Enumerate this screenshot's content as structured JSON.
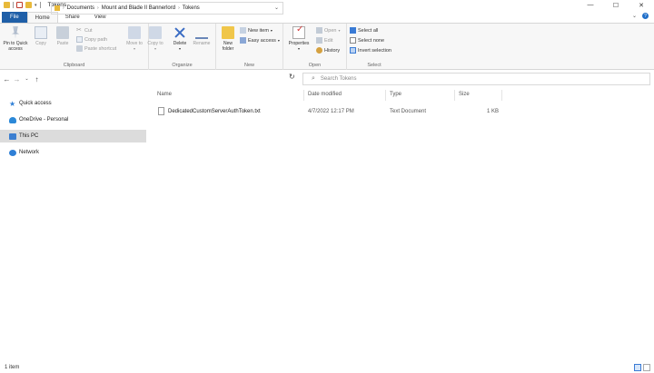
{
  "window": {
    "title": "Tokens",
    "controls": [
      "—",
      "☐",
      "✕"
    ]
  },
  "ribbon_tabs": [
    {
      "label": "File"
    },
    {
      "label": "Home"
    },
    {
      "label": "Share"
    },
    {
      "label": "View"
    }
  ],
  "ribbon": {
    "clipboard": {
      "label": "Clipboard",
      "pin_quick_access": "Pin to Quick access",
      "copy": "Copy",
      "paste": "Paste",
      "cut": "Cut",
      "copy_path": "Copy path",
      "paste_shortcut": "Paste shortcut"
    },
    "organize": {
      "label": "Organize",
      "move_to": "Move to",
      "copy_to": "Copy to",
      "delete": "Delete",
      "rename": "Rename"
    },
    "new": {
      "label": "New",
      "new_folder": "New folder",
      "new_item": "New item",
      "easy_access": "Easy access"
    },
    "open": {
      "label": "Open",
      "properties": "Properties",
      "open": "Open",
      "edit": "Edit",
      "history": "History"
    },
    "select": {
      "label": "Select",
      "select_all": "Select all",
      "select_none": "Select none",
      "invert_selection": "Invert selection"
    }
  },
  "address_bar": {
    "crumbs": [
      "Documents",
      "Mount and Blade II Bannerlord",
      "Tokens"
    ],
    "search_placeholder": "Search Tokens"
  },
  "nav_pane": {
    "items": [
      {
        "label": "Quick access",
        "icon": "star-icon"
      },
      {
        "label": "OneDrive - Personal",
        "icon": "cloud-icon"
      },
      {
        "label": "This PC",
        "icon": "computer-icon",
        "selected": true
      },
      {
        "label": "Network",
        "icon": "network-icon"
      }
    ]
  },
  "file_list": {
    "columns": [
      "Name",
      "Date modified",
      "Type",
      "Size"
    ],
    "rows": [
      {
        "name": "DedicatedCustomServerAuthToken.txt",
        "date_modified": "4/7/2022 12:17 PM",
        "type": "Text Document",
        "size": "1 KB"
      }
    ]
  },
  "status_bar": {
    "item_count": "1 item"
  },
  "colors": {
    "file_tab": "#1f5fa8",
    "selected_nav": "#dcdcdc",
    "accent": "#3a7bd5"
  }
}
